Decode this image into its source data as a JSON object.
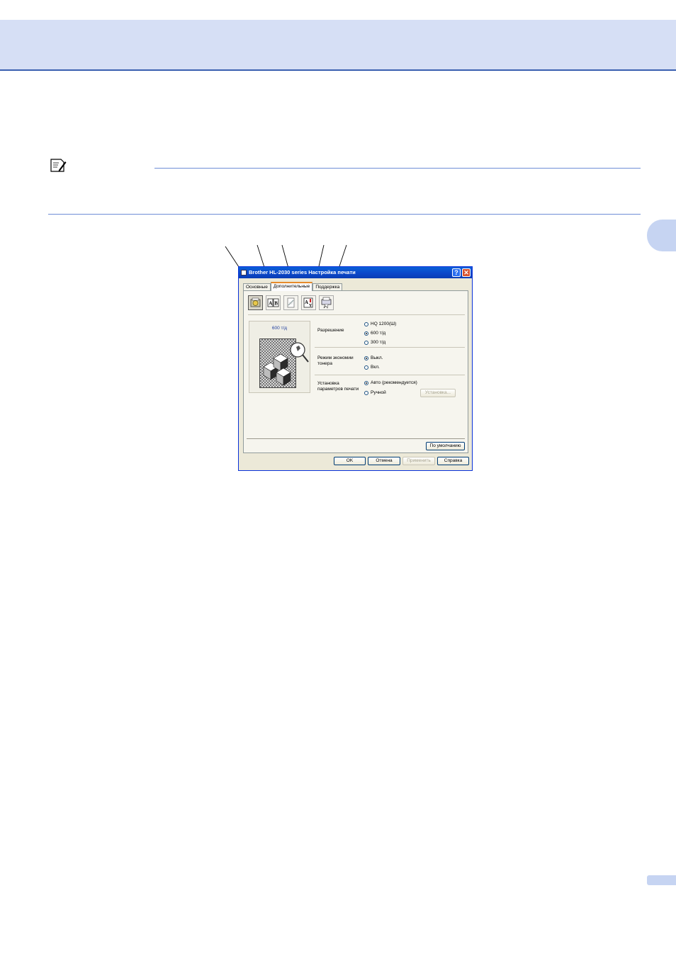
{
  "dialog": {
    "title": "Brother HL-2030 series Настройка печати",
    "help_button": "?",
    "close_button": "✕",
    "tabs": [
      {
        "label": "Основные"
      },
      {
        "label": "Дополнительные"
      },
      {
        "label": "Поддержка"
      }
    ],
    "preview_label": "600 т/д",
    "resolution": {
      "label": "Разрешение",
      "options": [
        "HQ 1200(Ш)",
        "600 т/д",
        "300 т/д"
      ],
      "selected": "600 т/д"
    },
    "toner_save": {
      "label": "Режим экономии тонера",
      "options": [
        "Выкл.",
        "Вкл."
      ],
      "selected": "Выкл."
    },
    "print_setup": {
      "label": "Установка параметров печати",
      "options": [
        "Авто (рекомендуется)",
        "Ручной"
      ],
      "selected": "Авто (рекомендуется)",
      "settings_button": "Установка..."
    },
    "default_button": "По умолчанию",
    "ok_button": "OK",
    "cancel_button": "Отмена",
    "apply_button": "Применить",
    "help_footer_button": "Справка",
    "icons": [
      "print-quality-icon",
      "duplex-icon",
      "watermark-icon",
      "page-setting-icon",
      "device-options-icon"
    ]
  },
  "callout_count": 5
}
